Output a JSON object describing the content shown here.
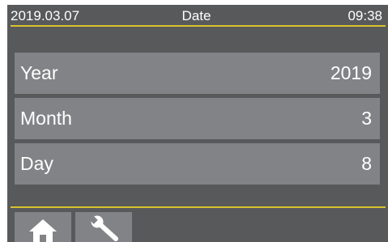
{
  "status_bar": {
    "date": "2019.03.07",
    "title": "Date",
    "time": "09:38"
  },
  "fields": [
    {
      "label": "Year",
      "value": "2019"
    },
    {
      "label": "Month",
      "value": "3"
    },
    {
      "label": "Day",
      "value": "8"
    }
  ],
  "nav": {
    "home_icon": "home-icon",
    "settings_icon": "wrench-icon"
  },
  "colors": {
    "background": "#58595b",
    "row": "#828386",
    "accent": "#d8c22e",
    "text": "#ffffff"
  }
}
